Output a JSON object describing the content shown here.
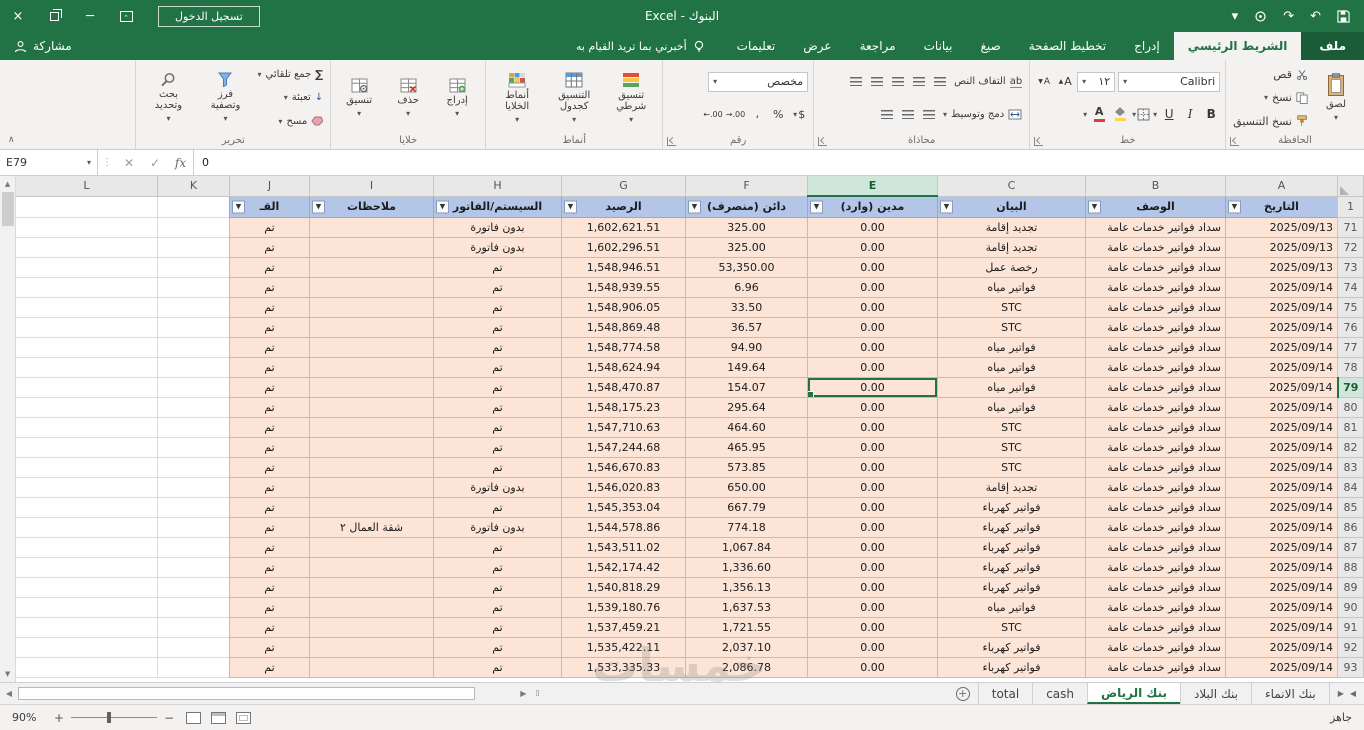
{
  "title_bar": {
    "title": "البنوك - Excel",
    "sign_in_label": "تسجيل الدخول"
  },
  "ribbon_tabs": {
    "file": "ملف",
    "items": [
      "الشريط الرئيسي",
      "إدراج",
      "تخطيط الصفحة",
      "صيغ",
      "بيانات",
      "مراجعة",
      "عرض",
      "تعليمات"
    ],
    "active": "الشريط الرئيسي",
    "tell_me": "أخبرني بما تريد القيام به",
    "share": "مشاركة"
  },
  "ribbon": {
    "clipboard": {
      "label": "الحافظة",
      "paste": "لصق",
      "cut": "قص",
      "copy": "نسخ",
      "format_painter": "نسخ التنسيق"
    },
    "font": {
      "label": "خط",
      "name": "Calibri",
      "size": "١٢",
      "bold": "B",
      "italic": "I",
      "underline": "U",
      "grow": "A",
      "shrink": "A",
      "color_letter": "A"
    },
    "alignment": {
      "label": "محاذاة",
      "wrap_text": "التفاف النص",
      "merge_center": "دمج وتوسيط",
      "wrap_glyph": "ab"
    },
    "number": {
      "label": "رقم",
      "format": "مخصص",
      "currency": "$",
      "percent": "%",
      "comma": "،",
      "inc_decimal": "→.00",
      "dec_decimal": "←.00"
    },
    "styles": {
      "label": "أنماط",
      "conditional": "تنسيق شرطي",
      "format_as_table": "التنسيق كجدول",
      "cell_styles": "أنماط الخلايا"
    },
    "cells": {
      "label": "خلايا",
      "insert": "إدراج",
      "delete": "حذف",
      "format": "تنسيق"
    },
    "editing": {
      "label": "تحرير",
      "autosum": "جمع تلقائي",
      "autosum_glyph": "∑",
      "fill": "تعبئة",
      "clear": "مسح",
      "sort_filter": "فرز وتصفية",
      "find_select": "بحث وتحديد"
    }
  },
  "formula_bar": {
    "name_box": "E79",
    "value": "0",
    "fx": "fx"
  },
  "sheet": {
    "columns": [
      "A",
      "B",
      "C",
      "E",
      "F",
      "G",
      "H",
      "I",
      "J",
      "K",
      "L"
    ],
    "corner_row_label": "1",
    "header_cells": [
      "التاريخ",
      "الوصف",
      "البيان",
      "مدين (وارد)",
      "دائن (منصرف)",
      "الرصيد",
      "السيستم/الفاتور",
      "ملاحظات",
      "القـ"
    ],
    "selected": {
      "column": "E",
      "row": "79",
      "cell": "E79"
    },
    "rows": [
      [
        "71",
        "2025/09/13",
        "سداد فواتير خدمات عامة",
        "تجديد إقامة",
        "0.00",
        "325.00",
        "1,602,621.51",
        "بدون فاتورة",
        "",
        "تم"
      ],
      [
        "72",
        "2025/09/13",
        "سداد فواتير خدمات عامة",
        "تجديد إقامة",
        "0.00",
        "325.00",
        "1,602,296.51",
        "بدون فاتورة",
        "",
        "تم"
      ],
      [
        "73",
        "2025/09/13",
        "سداد فواتير خدمات عامة",
        "رخصة عمل",
        "0.00",
        "53,350.00",
        "1,548,946.51",
        "تم",
        "",
        "تم"
      ],
      [
        "74",
        "2025/09/14",
        "سداد فواتير خدمات عامة",
        "فواتير مياه",
        "0.00",
        "6.96",
        "1,548,939.55",
        "تم",
        "",
        "تم"
      ],
      [
        "75",
        "2025/09/14",
        "سداد فواتير خدمات عامة",
        "STC",
        "0.00",
        "33.50",
        "1,548,906.05",
        "تم",
        "",
        "تم"
      ],
      [
        "76",
        "2025/09/14",
        "سداد فواتير خدمات عامة",
        "STC",
        "0.00",
        "36.57",
        "1,548,869.48",
        "تم",
        "",
        "تم"
      ],
      [
        "77",
        "2025/09/14",
        "سداد فواتير خدمات عامة",
        "فواتير مياه",
        "0.00",
        "94.90",
        "1,548,774.58",
        "تم",
        "",
        "تم"
      ],
      [
        "78",
        "2025/09/14",
        "سداد فواتير خدمات عامة",
        "فواتير مياه",
        "0.00",
        "149.64",
        "1,548,624.94",
        "تم",
        "",
        "تم"
      ],
      [
        "79",
        "2025/09/14",
        "سداد فواتير خدمات عامة",
        "فواتير مياه",
        "0.00",
        "154.07",
        "1,548,470.87",
        "تم",
        "",
        "تم"
      ],
      [
        "80",
        "2025/09/14",
        "سداد فواتير خدمات عامة",
        "فواتير مياه",
        "0.00",
        "295.64",
        "1,548,175.23",
        "تم",
        "",
        "تم"
      ],
      [
        "81",
        "2025/09/14",
        "سداد فواتير خدمات عامة",
        "STC",
        "0.00",
        "464.60",
        "1,547,710.63",
        "تم",
        "",
        "تم"
      ],
      [
        "82",
        "2025/09/14",
        "سداد فواتير خدمات عامة",
        "STC",
        "0.00",
        "465.95",
        "1,547,244.68",
        "تم",
        "",
        "تم"
      ],
      [
        "83",
        "2025/09/14",
        "سداد فواتير خدمات عامة",
        "STC",
        "0.00",
        "573.85",
        "1,546,670.83",
        "تم",
        "",
        "تم"
      ],
      [
        "84",
        "2025/09/14",
        "سداد فواتير خدمات عامة",
        "تجديد إقامة",
        "0.00",
        "650.00",
        "1,546,020.83",
        "بدون فاتورة",
        "",
        "تم"
      ],
      [
        "85",
        "2025/09/14",
        "سداد فواتير خدمات عامة",
        "فواتير كهرباء",
        "0.00",
        "667.79",
        "1,545,353.04",
        "تم",
        "",
        "تم"
      ],
      [
        "86",
        "2025/09/14",
        "سداد فواتير خدمات عامة",
        "فواتير كهرباء",
        "0.00",
        "774.18",
        "1,544,578.86",
        "بدون فاتورة",
        "شقة العمال ٢",
        "تم"
      ],
      [
        "87",
        "2025/09/14",
        "سداد فواتير خدمات عامة",
        "فواتير كهرباء",
        "0.00",
        "1,067.84",
        "1,543,511.02",
        "تم",
        "",
        "تم"
      ],
      [
        "88",
        "2025/09/14",
        "سداد فواتير خدمات عامة",
        "فواتير كهرباء",
        "0.00",
        "1,336.60",
        "1,542,174.42",
        "تم",
        "",
        "تم"
      ],
      [
        "89",
        "2025/09/14",
        "سداد فواتير خدمات عامة",
        "فواتير كهرباء",
        "0.00",
        "1,356.13",
        "1,540,818.29",
        "تم",
        "",
        "تم"
      ],
      [
        "90",
        "2025/09/14",
        "سداد فواتير خدمات عامة",
        "فواتير مياه",
        "0.00",
        "1,637.53",
        "1,539,180.76",
        "تم",
        "",
        "تم"
      ],
      [
        "91",
        "2025/09/14",
        "سداد فواتير خدمات عامة",
        "STC",
        "0.00",
        "1,721.55",
        "1,537,459.21",
        "تم",
        "",
        "تم"
      ],
      [
        "92",
        "2025/09/14",
        "سداد فواتير خدمات عامة",
        "فواتير كهرباء",
        "0.00",
        "2,037.10",
        "1,535,422.11",
        "تم",
        "",
        "تم"
      ],
      [
        "93",
        "2025/09/14",
        "سداد فواتير خدمات عامة",
        "فواتير كهرباء",
        "0.00",
        "2,086.78",
        "1,533,335.33",
        "تم",
        "",
        "تم"
      ]
    ]
  },
  "sheet_tabs": {
    "items": [
      "بنك الانماء",
      "بنك البلاد",
      "بنك الرياض",
      "cash",
      "total"
    ],
    "active": "بنك الرياض"
  },
  "status_bar": {
    "ready": "جاهز",
    "zoom": "90%"
  },
  "watermark": "خمسات",
  "colors": {
    "accent": "#217346",
    "table_header": "#b4c6e7",
    "table_row": "#fce4d6",
    "selection_header": "#cfe7da"
  }
}
